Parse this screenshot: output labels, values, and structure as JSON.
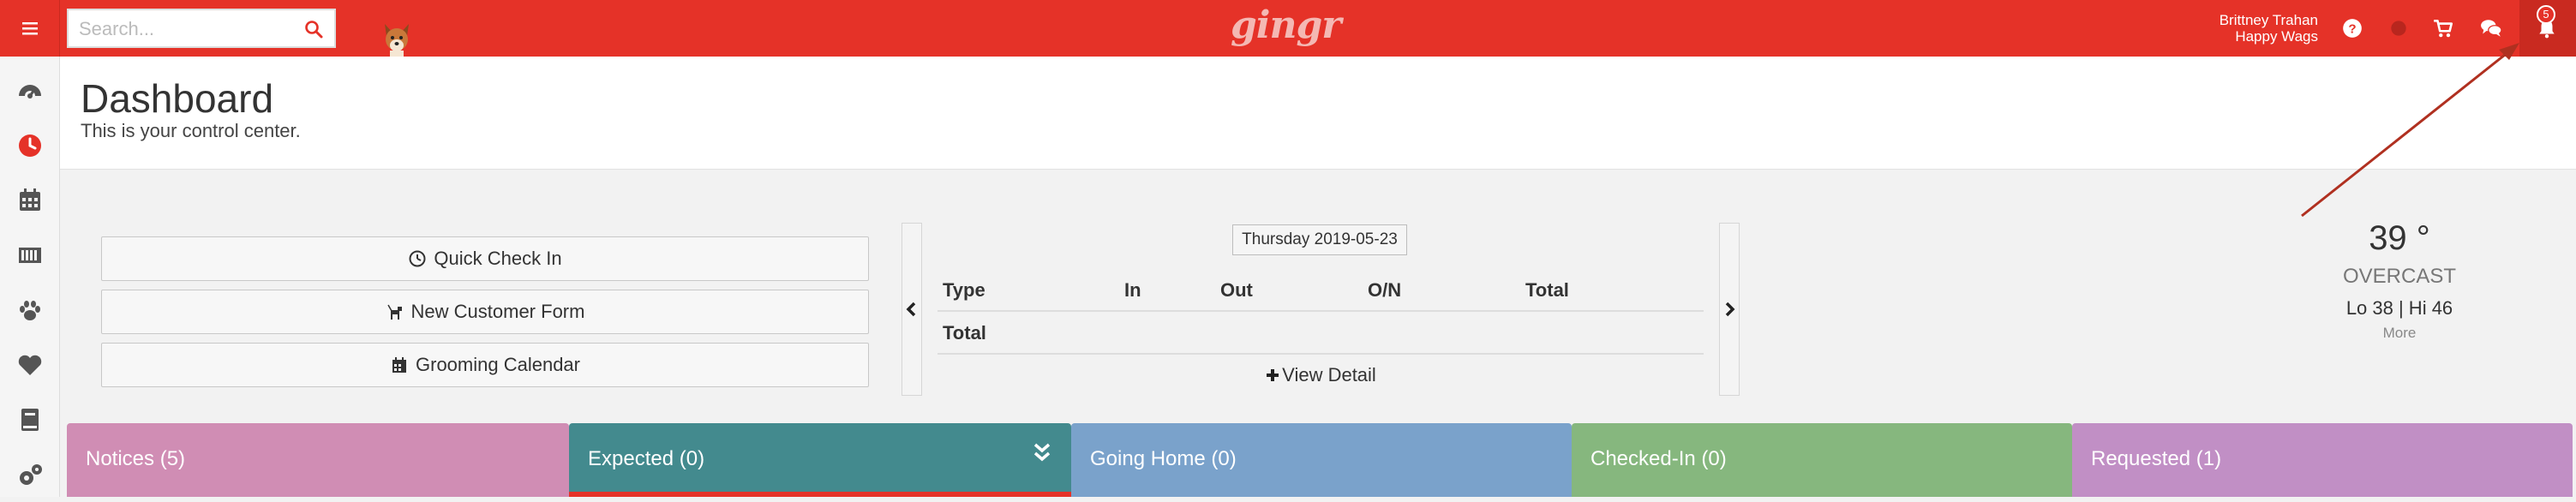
{
  "search": {
    "placeholder": "Search..."
  },
  "brand": {
    "name": "gingr"
  },
  "user": {
    "name": "Brittney Trahan",
    "business": "Happy Wags"
  },
  "notifications": {
    "count": "5"
  },
  "header": {
    "title": "Dashboard",
    "subtitle": "This is your control center."
  },
  "quick_actions": [
    {
      "label": "Quick Check In",
      "icon": "clock-icon"
    },
    {
      "label": "New Customer Form",
      "icon": "dog-walk-icon"
    },
    {
      "label": "Grooming Calendar",
      "icon": "calendar-icon"
    }
  ],
  "stats": {
    "date": "Thursday 2019-05-23",
    "columns": [
      "Type",
      "In",
      "Out",
      "O/N",
      "Total"
    ],
    "rows": [
      {
        "type": "Total"
      }
    ],
    "view_detail": "View Detail"
  },
  "weather": {
    "temp": "39 °",
    "condition": "OVERCAST",
    "range": "Lo 38 | Hi 46",
    "more": "More"
  },
  "tiles": [
    {
      "label": "Notices (5)",
      "color": "#d08db4"
    },
    {
      "label": "Expected (0)",
      "color": "#438a8e"
    },
    {
      "label": "Going Home (0)",
      "color": "#7aa2cb"
    },
    {
      "label": "Checked-In (0)",
      "color": "#86b77e"
    },
    {
      "label": "Requested (1)",
      "color": "#c18fc5"
    }
  ],
  "colors": {
    "topbar": "#e53228",
    "accent": "#e53228"
  },
  "sidebar": {
    "items": [
      {
        "icon": "dashboard-gauge-icon"
      },
      {
        "icon": "clock-icon",
        "active": true
      },
      {
        "icon": "calendar-icon"
      },
      {
        "icon": "kennel-bars-icon"
      },
      {
        "icon": "paw-icon"
      },
      {
        "icon": "heart-icon"
      },
      {
        "icon": "book-icon"
      },
      {
        "icon": "gears-icon"
      }
    ]
  }
}
